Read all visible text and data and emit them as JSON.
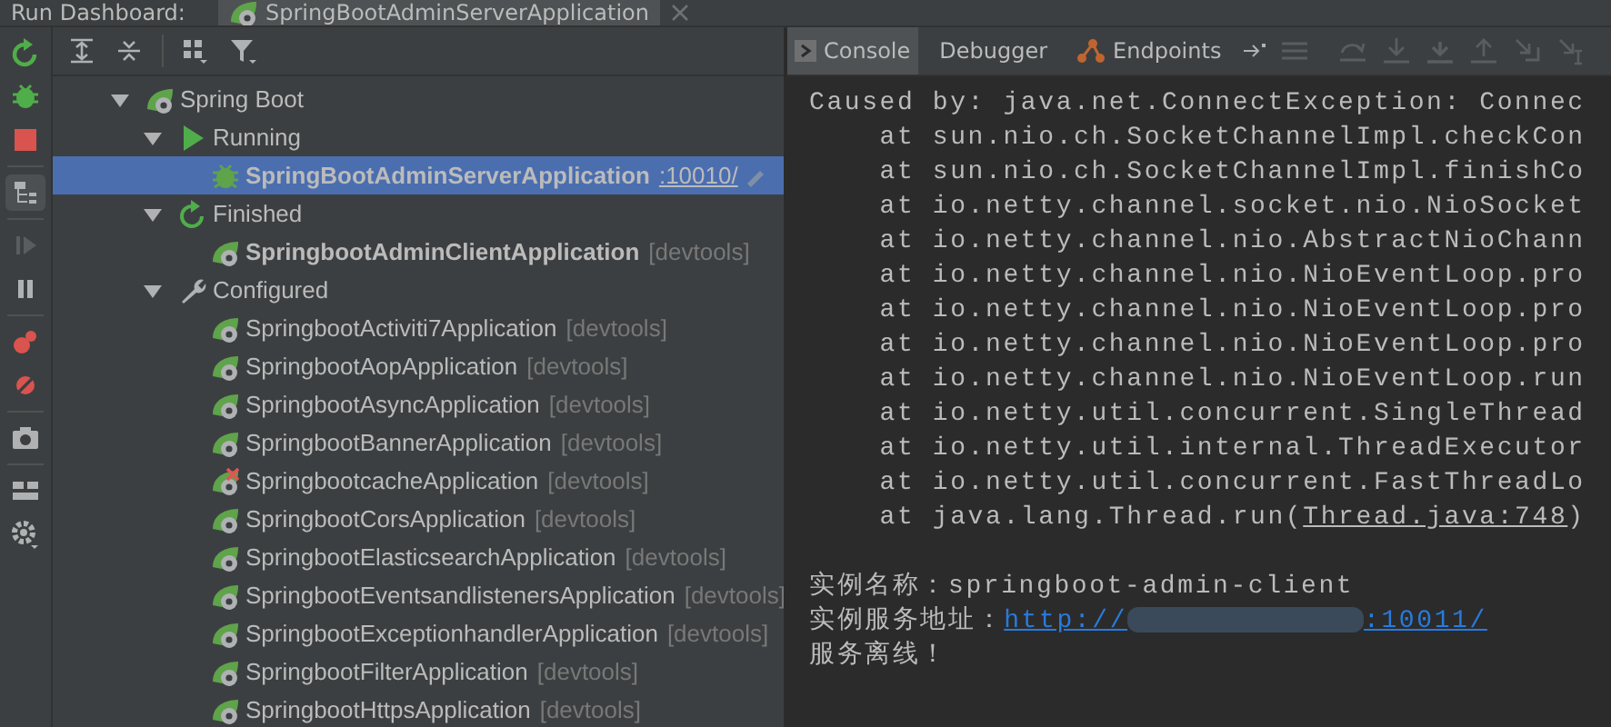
{
  "header": {
    "title": "Run Dashboard:",
    "tab": {
      "label": "SpringBootAdminServerApplication",
      "selected": true
    }
  },
  "tree": [
    {
      "label": "Spring Boot",
      "kind": "spring",
      "expanded": true,
      "children": [
        {
          "label": "Running",
          "kind": "running",
          "expanded": true,
          "children": [
            {
              "label": "SpringBootAdminServerApplication",
              "kind": "debugging",
              "launched": true,
              "port": ":10010/",
              "selected": true
            }
          ]
        },
        {
          "label": "Finished",
          "kind": "finished",
          "expanded": true,
          "children": [
            {
              "label": "SpringbootAdminClientApplication",
              "kind": "spring",
              "launched": true,
              "tag": "[devtools]",
              "selected": false
            }
          ]
        },
        {
          "label": "Configured",
          "kind": "configured",
          "expanded": true,
          "children": [
            {
              "label": "SpringbootActiviti7Application",
              "kind": "spring",
              "launched": false,
              "tag": "[devtools]",
              "selected": false
            },
            {
              "label": "SpringbootAopApplication",
              "kind": "spring",
              "launched": false,
              "tag": "[devtools]",
              "selected": false
            },
            {
              "label": "SpringbootAsyncApplication",
              "kind": "spring",
              "launched": false,
              "tag": "[devtools]",
              "selected": false
            },
            {
              "label": "SpringbootBannerApplication",
              "kind": "spring",
              "launched": false,
              "tag": "[devtools]",
              "selected": false
            },
            {
              "label": "SpringbootcacheApplication",
              "kind": "spring-error",
              "launched": false,
              "tag": "[devtools]",
              "selected": false
            },
            {
              "label": "SpringbootCorsApplication",
              "kind": "spring",
              "launched": false,
              "tag": "[devtools]",
              "selected": false
            },
            {
              "label": "SpringbootElasticsearchApplication",
              "kind": "spring",
              "launched": false,
              "tag": "[devtools]",
              "selected": false
            },
            {
              "label": "SpringbootEventsandlistenersApplication",
              "kind": "spring",
              "launched": false,
              "tag": "[devtools]",
              "selected": false
            },
            {
              "label": "SpringbootExceptionhandlerApplication",
              "kind": "spring",
              "launched": false,
              "tag": "[devtools]",
              "selected": false
            },
            {
              "label": "SpringbootFilterApplication",
              "kind": "spring",
              "launched": false,
              "tag": "[devtools]",
              "selected": false
            },
            {
              "label": "SpringbootHttpsApplication",
              "kind": "spring",
              "launched": false,
              "tag": "[devtools]",
              "selected": false
            }
          ]
        }
      ]
    }
  ],
  "console_tabs": [
    {
      "label": "Console",
      "kind": "console",
      "selected": true
    },
    {
      "label": "Debugger",
      "kind": "debugger",
      "selected": false
    },
    {
      "label": "Endpoints",
      "kind": "endpoints",
      "selected": false
    }
  ],
  "trace": [
    {
      "text": "Caused by: java.net.ConnectException: Connec"
    },
    {
      "text": "    at sun.nio.ch.SocketChannelImpl.checkCon"
    },
    {
      "text": "    at sun.nio.ch.SocketChannelImpl.finishCo"
    },
    {
      "text": "    at io.netty.channel.socket.nio.NioSocket"
    },
    {
      "text": "    at io.netty.channel.nio.AbstractNioChann"
    },
    {
      "text": "    at io.netty.channel.nio.NioEventLoop.pro"
    },
    {
      "text": "    at io.netty.channel.nio.NioEventLoop.pro"
    },
    {
      "text": "    at io.netty.channel.nio.NioEventLoop.pro"
    },
    {
      "text": "    at io.netty.channel.nio.NioEventLoop.run"
    },
    {
      "text": "    at io.netty.util.concurrent.SingleThread"
    },
    {
      "text": "    at io.netty.util.internal.ThreadExecutor"
    },
    {
      "text": "    at io.netty.util.concurrent.FastThreadLo"
    },
    {
      "text": "    at java.lang.Thread.run(",
      "link": "Thread.java:748",
      "after": ")"
    }
  ],
  "message": [
    {
      "text": "实例名称：springboot-admin-client"
    },
    {
      "text": "实例服务地址：",
      "link": "http://",
      "redacted": true,
      "link_end": ":10011/"
    },
    {
      "text": "服务离线！"
    }
  ]
}
